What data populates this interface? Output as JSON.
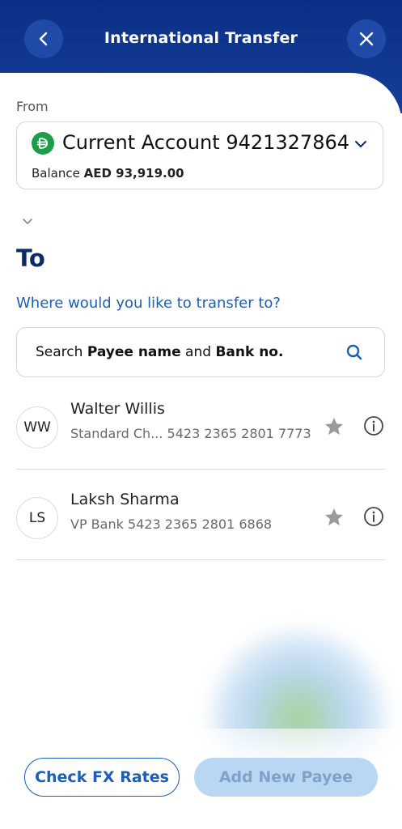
{
  "header": {
    "title": "International Transfer"
  },
  "from": {
    "label": "From",
    "account_name": "Current Account",
    "account_number": "9421327864",
    "balance_label": "Balance",
    "balance_value": "AED 93,919.00"
  },
  "to": {
    "title": "To",
    "prompt": "Where would you like to transfer to?",
    "search": {
      "prefix": "Search ",
      "bold1": "Payee name",
      "middle": " and ",
      "bold2": "Bank no."
    }
  },
  "payees": [
    {
      "initials": "WW",
      "name": "Walter Willis",
      "detail": "Standard Ch... 5423 2365 2801 7773"
    },
    {
      "initials": "LS",
      "name": "Laksh Sharma",
      "detail": "VP Bank 5423 2365 2801 6868"
    }
  ],
  "footer": {
    "fx_label": "Check FX Rates",
    "add_label": "Add New Payee"
  },
  "colors": {
    "header_bg": "#0a2f86",
    "accent_blue": "#1b5fb8",
    "title_navy": "#0c2b6b",
    "dirham_green": "#1a9e4b",
    "disabled_btn": "#b9d7f3"
  }
}
